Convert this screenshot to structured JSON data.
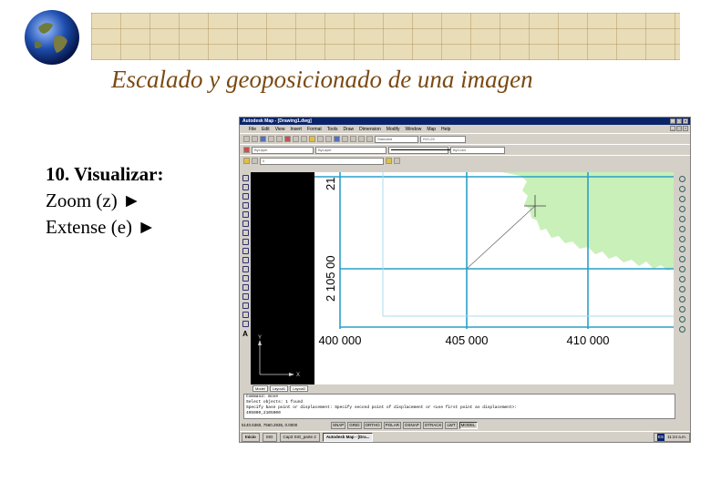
{
  "slide": {
    "title": "Escalado y  geoposicionado de una imagen",
    "notes": {
      "heading": "10. Visualizar:",
      "line1": "Zoom (z) ►",
      "line2": "Extense (e) ►"
    }
  },
  "app": {
    "window_title": "Autodesk Map - [Drawing1.dwg]",
    "window_buttons": [
      "_",
      "□",
      "×"
    ],
    "menu": [
      "File",
      "Edit",
      "View",
      "Insert",
      "Format",
      "Tools",
      "Draw",
      "Dimension",
      "Modify",
      "Window",
      "Map",
      "Help"
    ],
    "toolbar": {
      "text_style": "Standard",
      "dim_style": "ISO-25",
      "layer_value": "0",
      "linetype": "ByLayer",
      "lineweight": "ByLayer",
      "color": "ByColor"
    },
    "drawing": {
      "y_label_top": "21",
      "y_label_mid": "2 105 00",
      "x_labels": [
        "400 000",
        "405 000",
        "410 000"
      ],
      "ucs_y": "Y",
      "ucs_x": "X"
    },
    "tabs": [
      "Model",
      "Layout1",
      "Layout2"
    ],
    "command_lines": [
      "Command: move",
      "Select objects: 1 found",
      "Specify base point or displacement: Specify second point of displacement or <use first point as displacement>:",
      "405000,2105000"
    ],
    "status": {
      "coords": "5140.6360, 7560.2935, 0.0000",
      "toggles": [
        "SNAP",
        "GRID",
        "ORTHO",
        "POLAR",
        "OSNAP",
        "OTRACK",
        "LWT",
        "MODEL"
      ]
    },
    "taskbar": {
      "start": "Inicio",
      "items": [
        "SIG",
        "Cap3 SIG_parte 2",
        "Autodesk Map - [Dra..."
      ],
      "lang": "ES",
      "clock": "11:24 a.m."
    }
  },
  "colors": {
    "title_brown": "#7a4a12",
    "grid_blue": "#2aa0c8",
    "land_green": "#c8f0b8",
    "window_title_blue": "#0a246a"
  }
}
